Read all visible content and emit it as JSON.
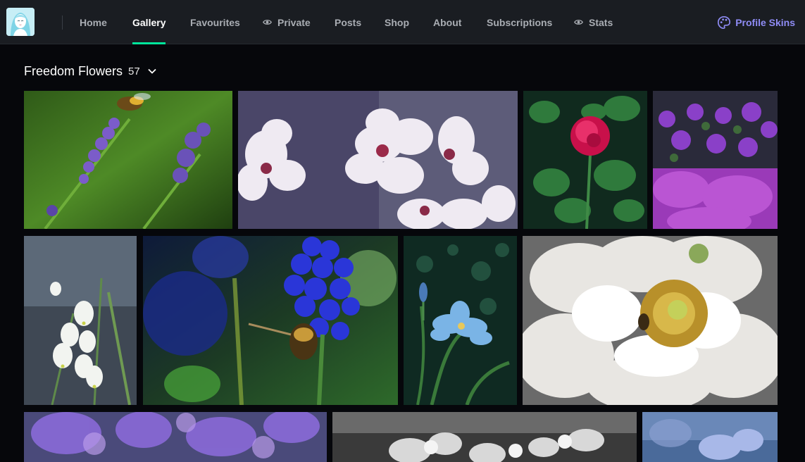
{
  "nav": {
    "items": [
      {
        "label": "Home",
        "active": false,
        "icon": ""
      },
      {
        "label": "Gallery",
        "active": true,
        "icon": ""
      },
      {
        "label": "Favourites",
        "active": false,
        "icon": ""
      },
      {
        "label": "Private",
        "active": false,
        "icon": "eye-icon"
      },
      {
        "label": "Posts",
        "active": false,
        "icon": ""
      },
      {
        "label": "Shop",
        "active": false,
        "icon": ""
      },
      {
        "label": "About",
        "active": false,
        "icon": ""
      },
      {
        "label": "Subscriptions",
        "active": false,
        "icon": ""
      },
      {
        "label": "Stats",
        "active": false,
        "icon": "eye-icon"
      }
    ],
    "profile_skins": {
      "label": "Profile Skins",
      "icon": "palette-icon"
    }
  },
  "colors": {
    "nav_background": "#1a1d22",
    "page_background": "#06070b",
    "active_underline": "#00e59b",
    "profile_skins_accent": "#8f8cf5"
  },
  "gallery": {
    "title": "Freedom Flowers",
    "count": "57",
    "icon": "chevron-down-icon"
  },
  "photos": [
    {
      "subject": "bee-on-lavender"
    },
    {
      "subject": "cherry-blossoms"
    },
    {
      "subject": "red-peony-bush"
    },
    {
      "subject": "purple-flower-field"
    },
    {
      "subject": "snowflake-flowers"
    },
    {
      "subject": "bee-on-grape-hyacinth"
    },
    {
      "subject": "blue-iris"
    },
    {
      "subject": "white-peony"
    },
    {
      "subject": "purple-flowers-blur"
    },
    {
      "subject": "monochrome-flowers"
    },
    {
      "subject": "blue-flower"
    }
  ]
}
